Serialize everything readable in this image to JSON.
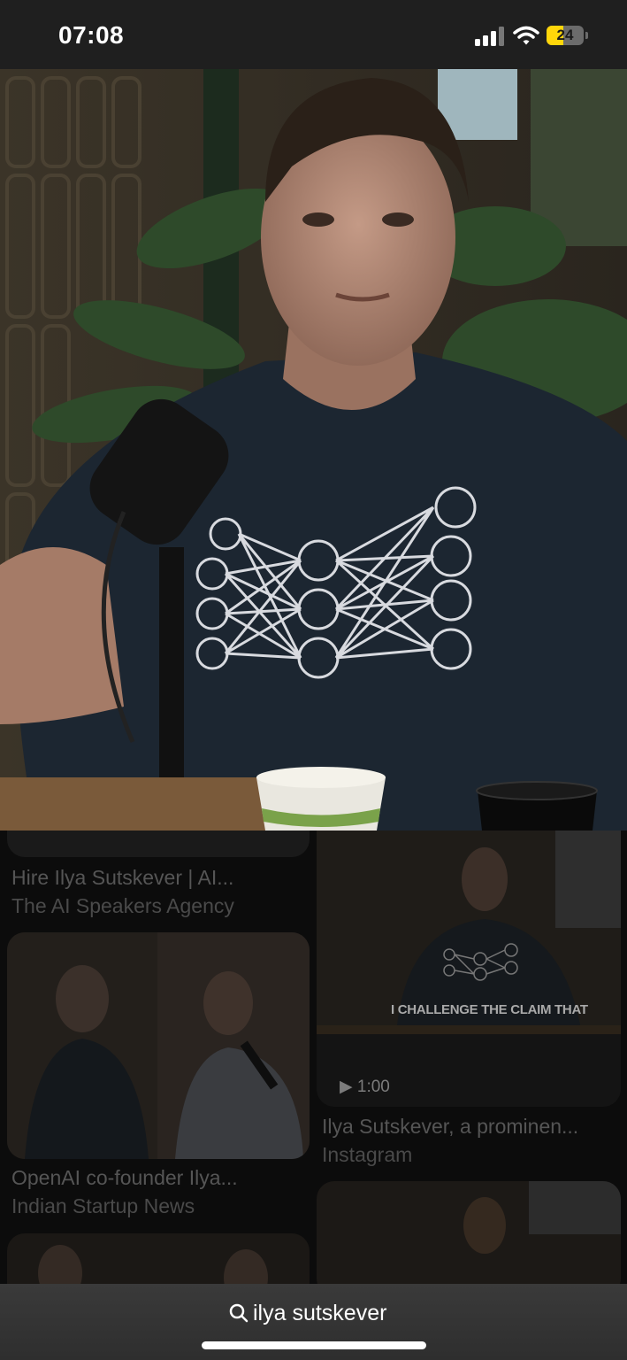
{
  "status_bar": {
    "time": "07:08",
    "battery_level": "24",
    "icons": [
      "cellular-signal-icon",
      "wifi-icon",
      "battery-icon"
    ]
  },
  "hero": {
    "description_icon": "photo-preview"
  },
  "results": [
    {
      "title": "Hire Ilya Sutskever | AI...",
      "source": "The AI Speakers Agency"
    },
    {
      "title": "OpenAI co-founder Ilya...",
      "source": "Indian Startup News"
    },
    {
      "title": "Ilya Sutskever, a prominen...",
      "source": "Instagram",
      "duration": "1:00",
      "overlay_text": "I CHALLENGE THE CLAIM THAT"
    }
  ],
  "search": {
    "query": "ilya sutskever",
    "icon": "search-icon"
  },
  "colors": {
    "status_bar_bg": "#1f1f1f",
    "battery_fill": "#ffd60a",
    "bottom_bar_bg": "#353535"
  }
}
